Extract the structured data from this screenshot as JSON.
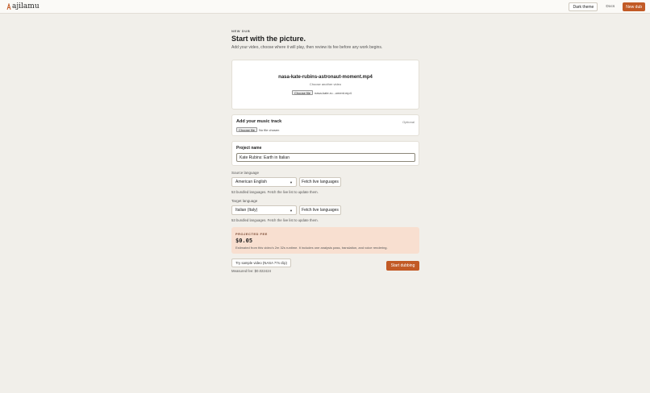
{
  "header": {
    "brand": "ajilamu",
    "theme_button": "Dark theme",
    "docs_link": "Docs",
    "new_dub_button": "New dub",
    "accent_color": "#c25a25"
  },
  "intro": {
    "eyebrow": "NEW DUB",
    "title": "Start with the picture.",
    "subtitle": "Add your video, choose where it will play, then review its fee before any work begins."
  },
  "video": {
    "file_name": "nasa-kate-rubins-astronaut-moment.mp4",
    "choose_another": "Choose another video",
    "file_button": "Choose file",
    "file_display": "nasa-kate-ru...oment.mp4"
  },
  "music": {
    "title": "Add your music track",
    "optional": "Optional",
    "file_button": "Choose file",
    "file_display": "No file chosen"
  },
  "project": {
    "label": "Project name",
    "value": "Kate Rubins: Earth in Italian"
  },
  "source_language": {
    "label": "Source language",
    "selected": "American English",
    "fetch_button": "Fetch live languages",
    "note": "53 bundled languages. Fetch the live list to update them."
  },
  "target_language": {
    "label": "Target language",
    "selected": "Italian (Italy)",
    "fetch_button": "Fetch live languages",
    "note": "53 bundled languages. Fetch the live list to update them."
  },
  "fee": {
    "eyebrow": "PROJECTED FEE",
    "value": "$0.05",
    "note": "Estimated from this video's 2m 32s runtime. It includes one analysis pass, translation, and voice rendering."
  },
  "actions": {
    "sample_button": "Try sample video (NASA 77s clip)",
    "measured_fee": "Measured fee: $0.022424",
    "start_button": "Start dubbing"
  }
}
